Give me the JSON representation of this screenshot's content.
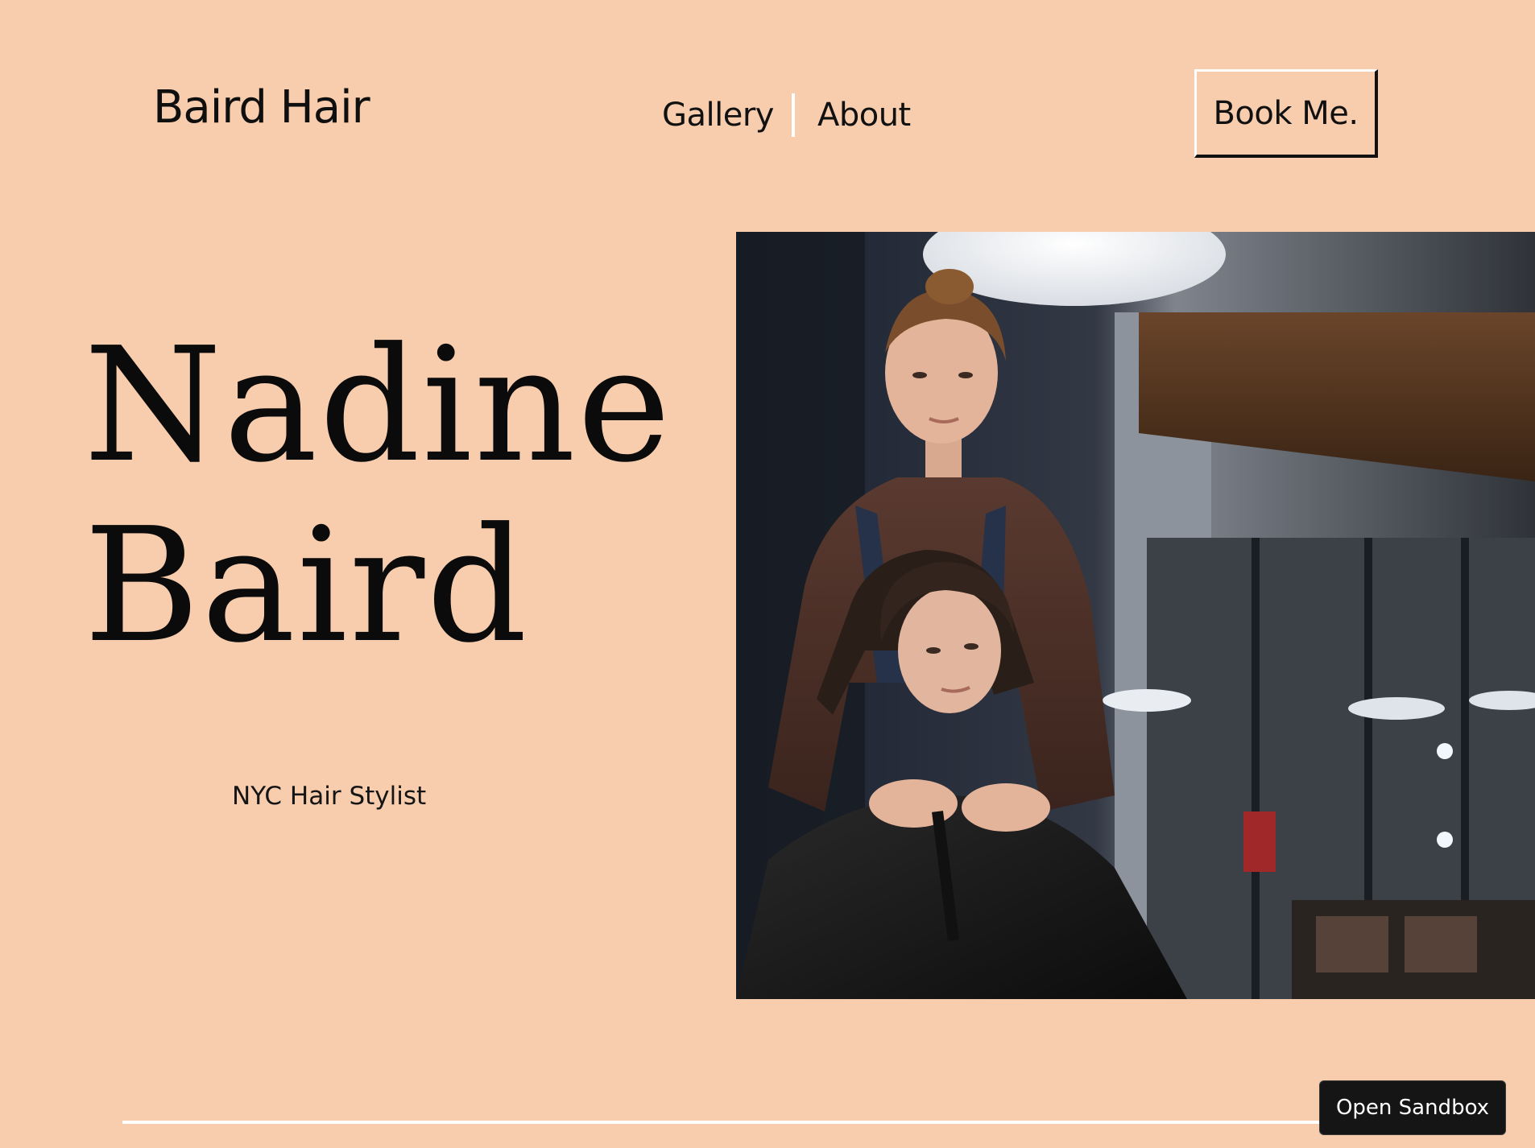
{
  "header": {
    "brand": "Baird Hair",
    "nav": [
      {
        "label": "Gallery"
      },
      {
        "label": "About"
      }
    ],
    "cta_label": "Book Me."
  },
  "hero": {
    "name_line_1": "Nadine",
    "name_line_2": "Baird",
    "subtitle": "NYC Hair Stylist"
  },
  "photo": {
    "description_icon": "stylist-photo"
  },
  "sandbox": {
    "label": "Open Sandbox"
  },
  "colors": {
    "background": "#f7cdae",
    "text": "#111111",
    "accent_line": "#ffffff",
    "sandbox_bg": "#151515"
  }
}
